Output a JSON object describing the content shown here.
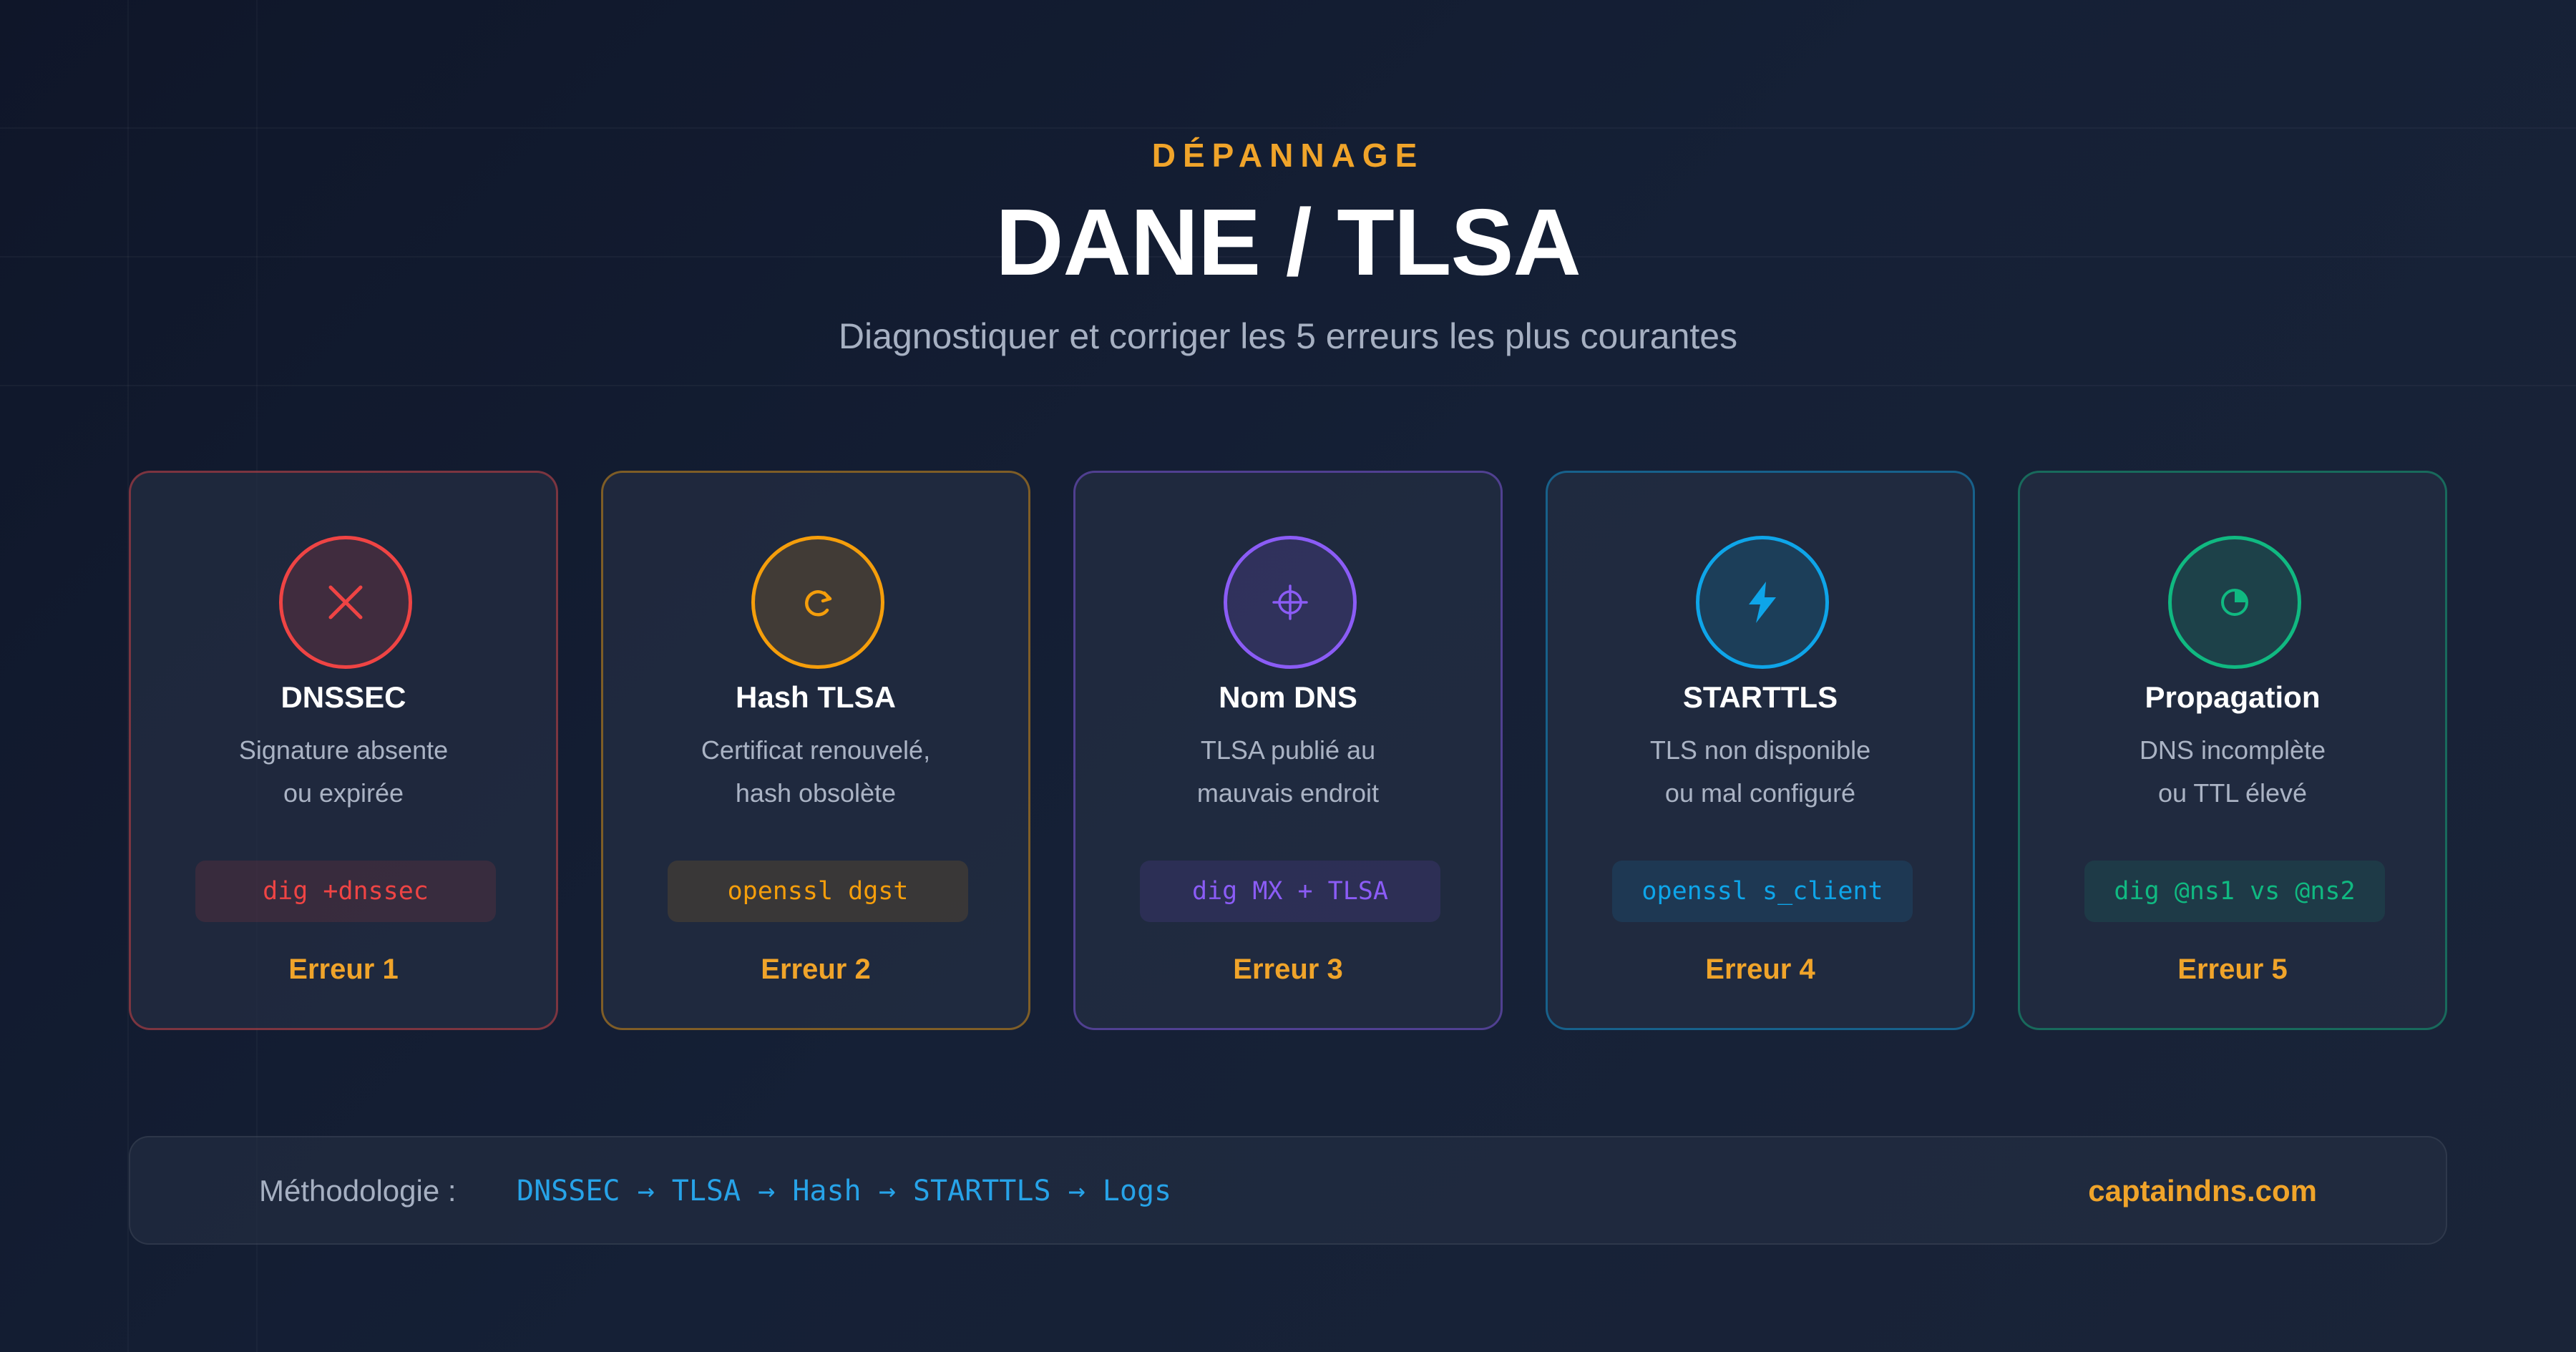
{
  "header": {
    "eyebrow": "DÉPANNAGE",
    "title": "DANE / TLSA",
    "subtitle": "Diagnostiquer et corriger les 5 erreurs les plus courantes"
  },
  "cards": [
    {
      "title": "DNSSEC",
      "desc1": "Signature absente",
      "desc2": "ou expirée",
      "command": "dig +dnssec",
      "error": "Erreur 1",
      "color": "#ef4444",
      "icon": "x-icon"
    },
    {
      "title": "Hash TLSA",
      "desc1": "Certificat renouvelé,",
      "desc2": "hash obsolète",
      "command": "openssl dgst",
      "error": "Erreur 2",
      "color": "#f59e0b",
      "icon": "refresh-icon"
    },
    {
      "title": "Nom DNS",
      "desc1": "TLSA publié au",
      "desc2": "mauvais endroit",
      "command": "dig MX + TLSA",
      "error": "Erreur 3",
      "color": "#8b5cf6",
      "icon": "crosshair-icon"
    },
    {
      "title": "STARTTLS",
      "desc1": "TLS non disponible",
      "desc2": "ou mal configuré",
      "command": "openssl s_client",
      "error": "Erreur 4",
      "color": "#0ea5e9",
      "icon": "lightning-icon"
    },
    {
      "title": "Propagation",
      "desc1": "DNS incomplète",
      "desc2": "ou TTL élevé",
      "command": "dig @ns1 vs @ns2",
      "error": "Erreur 5",
      "color": "#10b981",
      "icon": "clock-icon"
    }
  ],
  "footer": {
    "label": "Méthodologie :",
    "flow": "DNSSEC → TLSA → Hash → STARTTLS → Logs",
    "site": "captaindns.com"
  }
}
